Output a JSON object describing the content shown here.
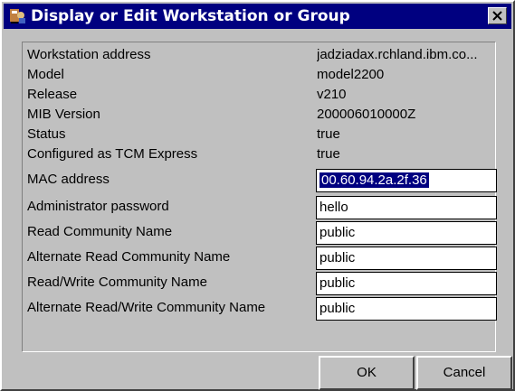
{
  "window": {
    "title": "Display or Edit Workstation or Group",
    "icon": "app-icon",
    "close_icon": "close-icon"
  },
  "info": [
    {
      "label": "Workstation address",
      "value": "jadziadax.rchland.ibm.co..."
    },
    {
      "label": "Model",
      "value": "model2200"
    },
    {
      "label": "Release",
      "value": "v210"
    },
    {
      "label": "MIB Version",
      "value": "200006010000Z"
    },
    {
      "label": "Status",
      "value": "true"
    },
    {
      "label": "Configured as TCM Express",
      "value": "true"
    }
  ],
  "fields": [
    {
      "label": "MAC address",
      "value": "00.60.94.2a.2f.36",
      "selected": true
    },
    {
      "label": "Administrator password",
      "value": "hello"
    },
    {
      "label": "Read Community Name",
      "value": "public"
    },
    {
      "label": "Alternate Read Community Name",
      "value": "public"
    },
    {
      "label": "Read/Write Community Name",
      "value": "public"
    },
    {
      "label": "Alternate Read/Write Community Name",
      "value": "public"
    }
  ],
  "buttons": {
    "ok": "OK",
    "cancel": "Cancel"
  },
  "colors": {
    "title_bar": "#000080",
    "selection": "#000080",
    "face": "#c0c0c0"
  }
}
